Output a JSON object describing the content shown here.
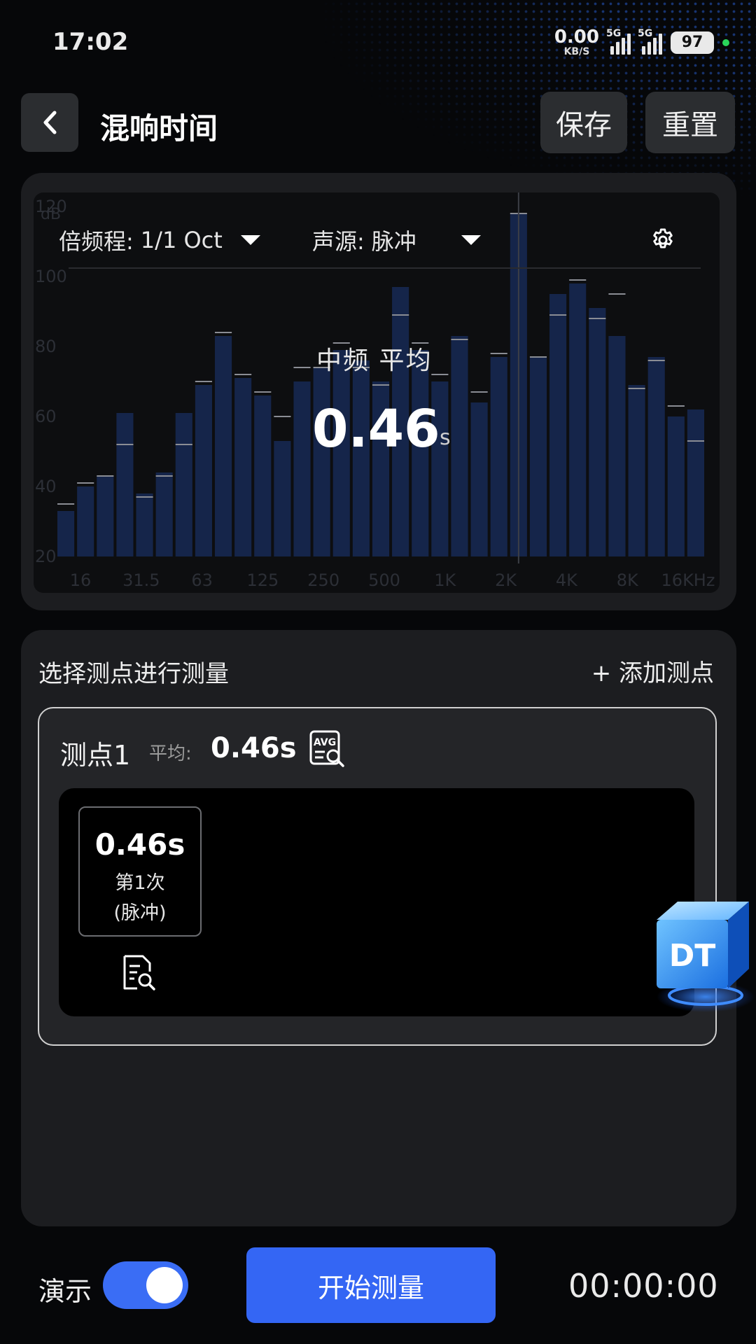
{
  "status_bar": {
    "time": "17:02",
    "net_speed": "0.00",
    "net_unit": "KB/S",
    "sim1_tag": "5G",
    "sim2_tag": "5G",
    "battery": "97"
  },
  "header": {
    "title": "混响时间",
    "save_label": "保存",
    "reset_label": "重置"
  },
  "chart_controls": {
    "band_label": "倍频程:",
    "band_value": "1/1 Oct",
    "source_label": "声源:",
    "source_value": "脉冲"
  },
  "overlay": {
    "label": "中频 平均",
    "value": "0.46",
    "unit": "s"
  },
  "chart_data": {
    "type": "bar",
    "ylabel": "dB",
    "ylim": [
      20,
      120
    ],
    "yticks": [
      "20",
      "40",
      "60",
      "80",
      "100",
      "120"
    ],
    "xticks": [
      "16",
      "31.5",
      "63",
      "125",
      "250",
      "500",
      "1K",
      "2K",
      "4K",
      "8K",
      "16KHz"
    ],
    "values": [
      33,
      40,
      43,
      61,
      38,
      44,
      61,
      69,
      83,
      71,
      66,
      53,
      70,
      74,
      79,
      76,
      70,
      97,
      79,
      70,
      83,
      64,
      77,
      118,
      77,
      95,
      98,
      91,
      83,
      69,
      77,
      60,
      62
    ],
    "peaks": [
      35,
      41,
      43,
      52,
      37,
      43,
      52,
      70,
      84,
      72,
      67,
      60,
      74,
      74,
      81,
      74,
      69,
      89,
      81,
      72,
      82,
      67,
      78,
      118,
      77,
      89,
      99,
      88,
      95,
      68,
      76,
      63,
      53
    ],
    "cursor_index": 23
  },
  "measure": {
    "title": "选择测点进行测量",
    "add_point": "+ 添加测点",
    "point": {
      "name": "测点1",
      "avg_label": "平均:",
      "avg_value": "0.46s",
      "avg_icon_text": "AVG"
    },
    "records": [
      {
        "value": "0.46s",
        "count": "第1次",
        "source": "(脉冲)"
      }
    ],
    "logo_text": "DT"
  },
  "bottom": {
    "demo_label": "演示",
    "demo_on": true,
    "start_label": "开始测量",
    "timer": "00:00:00"
  },
  "colors": {
    "accent": "#3466f4",
    "bar": "#15254a",
    "background": "#060709",
    "card": "#1c1d20"
  }
}
